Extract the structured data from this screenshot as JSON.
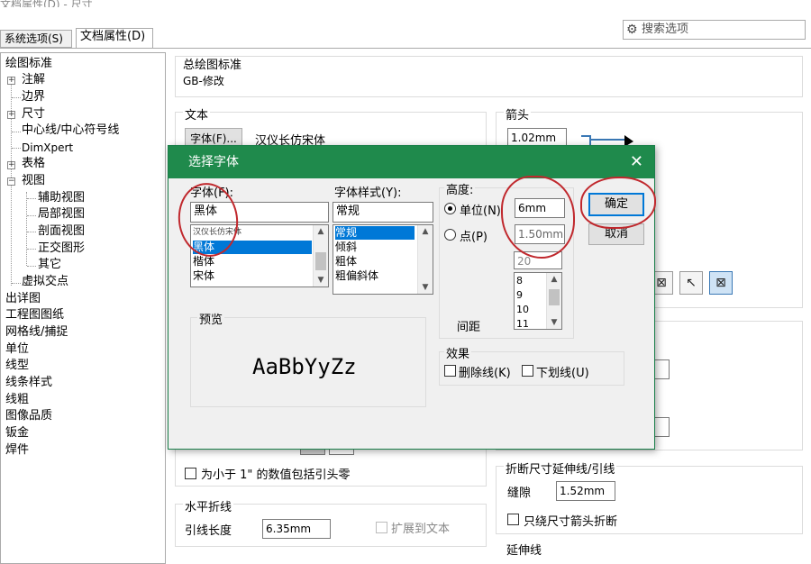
{
  "window": {
    "title_fragment": "文档属性(D) - 尺寸"
  },
  "search": {
    "placeholder": "搜索选项"
  },
  "tabs": [
    {
      "label": "系统选项(S)"
    },
    {
      "label": "文档属性(D)"
    }
  ],
  "tree": {
    "drafting_standard": "绘图标准",
    "annotations": "注解",
    "borders": "边界",
    "dimensions": "尺寸",
    "centerlines": "中心线/中心符号线",
    "dimxpert": "DimXpert",
    "tables": "表格",
    "views": "视图",
    "aux_view": "辅助视图",
    "detail_view": "局部视图",
    "section_view": "剖面视图",
    "ortho_view": "正交图形",
    "other": "其它",
    "virtual_sharps": "虚拟交点",
    "detailing": "出详图",
    "drawing_sheets": "工程图图纸",
    "grid_snap": "网格线/捕捉",
    "units": "单位",
    "line_font": "线型",
    "line_style": "线条样式",
    "line_thickness": "线粗",
    "image_quality": "图像品质",
    "sheet_metal": "钣金",
    "weldments": "焊件"
  },
  "main": {
    "overall_standard_label": "总绘图标准",
    "overall_standard_value": "GB-修改",
    "text_label": "文本",
    "font_button": "字体(F)...",
    "font_name": "汉仪长仿宋体",
    "arrows_label": "箭头",
    "arrow_size": "1.02mm",
    "leading_zero_label": "为小于 1\" 的数值包括引头零",
    "bent_leader_label": "水平折线",
    "leader_length_label": "引线长度",
    "leader_length_value": "6.35mm",
    "extend_to_text_label": "扩展到文本",
    "break_ext_label": "折断尺寸延伸线/引线",
    "gap_label": "缝隙",
    "gap_value": "1.52mm",
    "break_only_label": "只绕尺寸箭头折断",
    "ext_lines_label": "延伸线"
  },
  "dialog": {
    "title": "选择字体",
    "close": "✕",
    "font_label": "字体(F):",
    "font_value": "黑体",
    "font_list": [
      "汉仪长仿宋体",
      "黑体",
      "楷体",
      "宋体"
    ],
    "style_label": "字体样式(Y):",
    "style_value": "常规",
    "style_list": [
      "常规",
      "倾斜",
      "粗体",
      "粗偏斜体"
    ],
    "height_label": "高度:",
    "units_label": "单位(N)",
    "units_value": "6mm",
    "points_label": "点(P)",
    "points_value": "1.50mm",
    "point_size_value": "20",
    "point_list": [
      "8",
      "9",
      "10",
      "11"
    ],
    "spacing_label": "间距",
    "ok": "确定",
    "cancel": "取消",
    "preview_label": "预览",
    "preview_text": "AaBbYyZz",
    "effects_label": "效果",
    "strikeout_label": "删除线(K)",
    "underline_label": "下划线(U)"
  },
  "colors": {
    "dialog_title_bg": "#1f8a4c",
    "selection": "#0078d7",
    "annotation_red": "#c0282d"
  }
}
